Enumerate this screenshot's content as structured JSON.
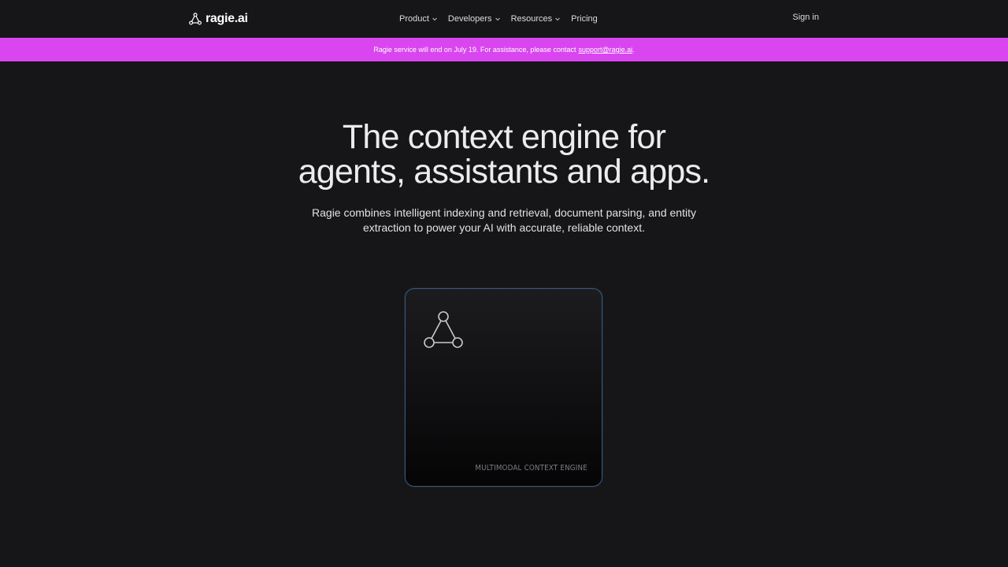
{
  "brand": {
    "name": "ragie.ai"
  },
  "nav": {
    "items": [
      {
        "label": "Product",
        "has_dropdown": true
      },
      {
        "label": "Developers",
        "has_dropdown": true
      },
      {
        "label": "Resources",
        "has_dropdown": true
      },
      {
        "label": "Pricing",
        "has_dropdown": false
      }
    ],
    "sign_in": "Sign in"
  },
  "banner": {
    "text": "Ragie service will end on July 19. For assistance, please contact",
    "email": "support@ragie.ai",
    "trailing": ".",
    "background": "#d946ef"
  },
  "hero": {
    "title_line1": "The context engine for",
    "title_line2": "agents, assistants and apps.",
    "subtitle": "Ragie combines intelligent indexing and retrieval, document parsing, and entity extraction to power your AI with accurate, reliable context."
  },
  "card": {
    "icon": "triangle-nodes-icon",
    "label": "MULTIMODAL CONTEXT ENGINE",
    "border_color": "#3a5878"
  }
}
